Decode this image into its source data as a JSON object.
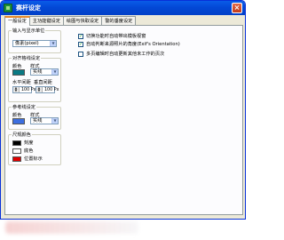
{
  "window": {
    "title": "赛杆设定",
    "close_label": "×"
  },
  "tabs": [
    {
      "label": "一般设定",
      "active": true
    },
    {
      "label": "主功能键设定",
      "active": false
    },
    {
      "label": "绘图与快取设定",
      "active": false
    },
    {
      "label": "警的垂度设定",
      "active": false
    }
  ],
  "unit_group": {
    "label": "输入与显示单位",
    "value": "像素(pixel)"
  },
  "align_group": {
    "label": "对齐格线设定",
    "color_label": "颜色",
    "style_label": "样式",
    "style_value": "实线",
    "color": "#0a7a84",
    "h_spacing_label": "水平间距",
    "v_spacing_label": "垂直间距",
    "h_spacing_value": "100",
    "h_spacing_unit": "Px",
    "v_spacing_value": "100",
    "v_spacing_unit": "Px"
  },
  "ref_group": {
    "label": "参考线设定",
    "color_label": "颜色",
    "style_label": "样式",
    "style_value": "实线",
    "color": "#3d6fe0"
  },
  "ruler_group": {
    "label": "尺规颜色",
    "items": [
      {
        "label": "刻度",
        "color": "#000000"
      },
      {
        "label": "底色",
        "color": "#ffffff"
      },
      {
        "label": "位置标示",
        "color": "#e00000"
      }
    ]
  },
  "options": [
    {
      "label": "切换功能时自动带出模板视窗",
      "checked": true
    },
    {
      "label": "自动判断来源照片的角度(Exif's Orientation)",
      "checked": true
    },
    {
      "label": "多页编辑时自动更新其他未工作的页次",
      "checked": false
    }
  ]
}
